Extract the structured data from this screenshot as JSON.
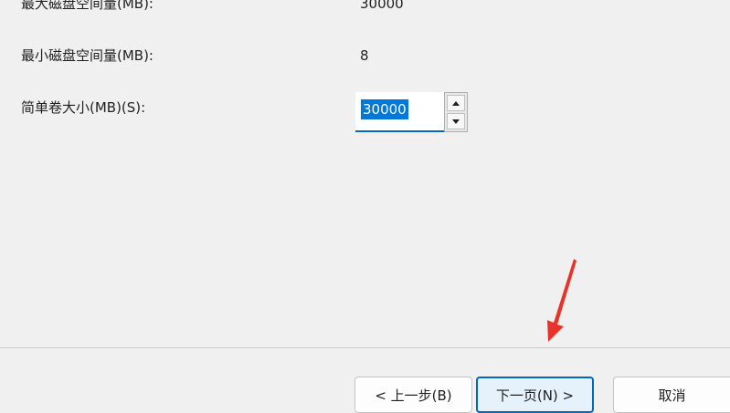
{
  "fields": {
    "max_disk_space": {
      "label": "最大磁盘空间量(MB):",
      "value": "30000"
    },
    "min_disk_space": {
      "label": "最小磁盘空间量(MB):",
      "value": "8"
    },
    "simple_volume_size": {
      "label": "简单卷大小(MB)(S):",
      "value": "30000"
    }
  },
  "spin": {
    "up_icon": "triangle-up",
    "down_icon": "triangle-down"
  },
  "buttons": {
    "back": "< 上一步(B)",
    "next": "下一页(N) >",
    "cancel": "取消"
  },
  "colors": {
    "accent": "#0067c0",
    "selection": "#0078d7",
    "annotation_arrow": "#e8332a"
  }
}
